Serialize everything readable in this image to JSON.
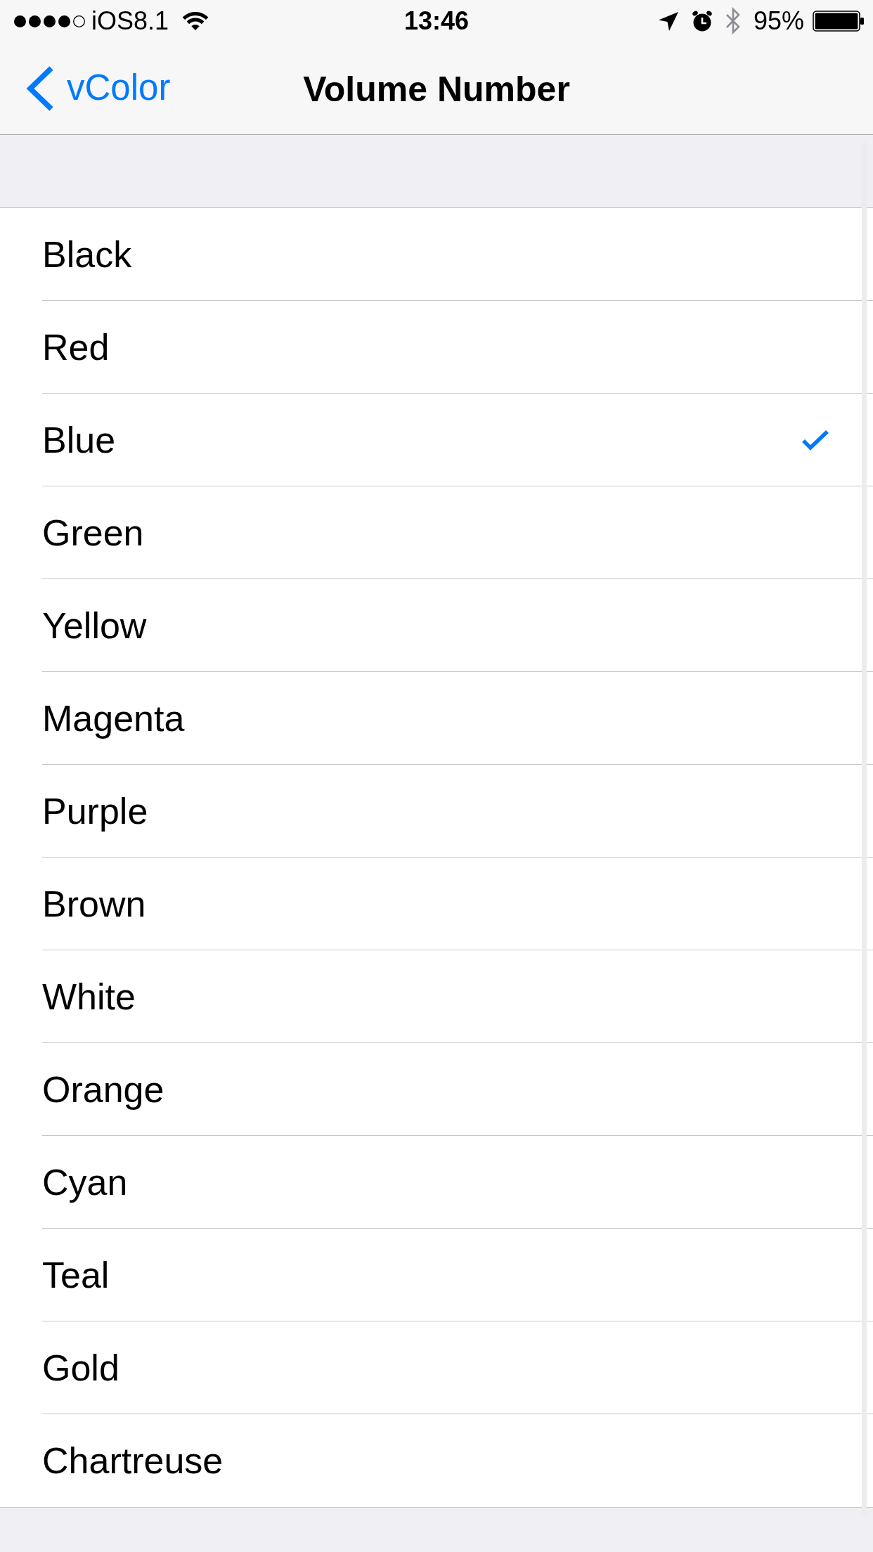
{
  "status_bar": {
    "carrier": "iOS8.1",
    "time": "13:46",
    "battery": "95%"
  },
  "nav_bar": {
    "back_label": "vColor",
    "title": "Volume Number"
  },
  "options": [
    {
      "label": "Black",
      "selected": false
    },
    {
      "label": "Red",
      "selected": false
    },
    {
      "label": "Blue",
      "selected": true
    },
    {
      "label": "Green",
      "selected": false
    },
    {
      "label": "Yellow",
      "selected": false
    },
    {
      "label": "Magenta",
      "selected": false
    },
    {
      "label": "Purple",
      "selected": false
    },
    {
      "label": "Brown",
      "selected": false
    },
    {
      "label": "White",
      "selected": false
    },
    {
      "label": "Orange",
      "selected": false
    },
    {
      "label": "Cyan",
      "selected": false
    },
    {
      "label": "Teal",
      "selected": false
    },
    {
      "label": "Gold",
      "selected": false
    },
    {
      "label": "Chartreuse",
      "selected": false
    }
  ]
}
